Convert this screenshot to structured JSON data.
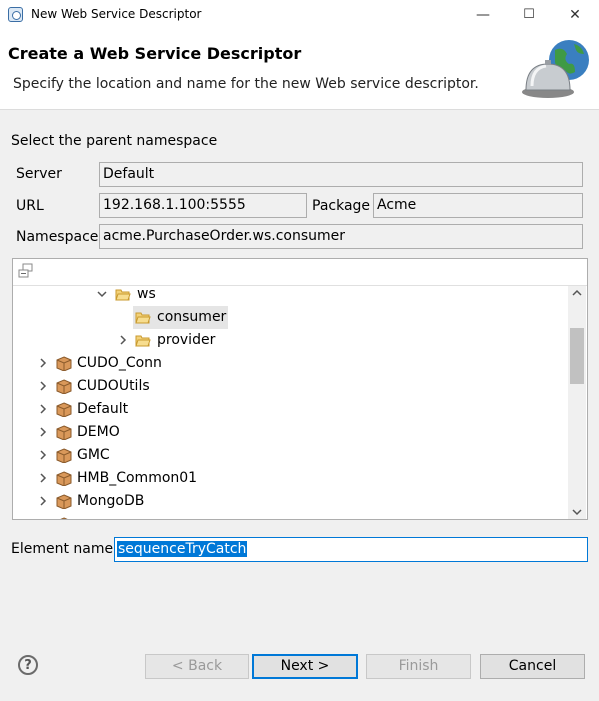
{
  "window": {
    "title": "New Web Service Descriptor",
    "controls": {
      "minimize": "—",
      "maximize": "☐",
      "close": "✕"
    }
  },
  "banner": {
    "title": "Create a Web Service Descriptor",
    "description": "Specify the location and name for the new Web service descriptor.",
    "image_icon": "service-bell-globe-icon"
  },
  "form": {
    "section_label": "Select the parent namespace",
    "server": {
      "label": "Server",
      "value": "Default"
    },
    "url": {
      "label": "URL",
      "value": "192.168.1.100:5555"
    },
    "package": {
      "label": "Package",
      "value": "Acme"
    },
    "namespace": {
      "label": "Namespace",
      "value": "acme.PurchaseOrder.ws.consumer"
    }
  },
  "tree": {
    "toolbar_icon": "collapse-all-icon",
    "items": [
      {
        "label": "ws",
        "type": "folder",
        "expanded": true
      },
      {
        "label": "consumer",
        "type": "folder",
        "selected": true
      },
      {
        "label": "provider",
        "type": "folder"
      },
      {
        "label": "CUDO_Conn",
        "type": "package"
      },
      {
        "label": "CUDOUtils",
        "type": "package"
      },
      {
        "label": "Default",
        "type": "package"
      },
      {
        "label": "DEMO",
        "type": "package"
      },
      {
        "label": "GMC",
        "type": "package"
      },
      {
        "label": "HMB_Common01",
        "type": "package"
      },
      {
        "label": "MongoDB",
        "type": "package"
      }
    ]
  },
  "element_name": {
    "label": "Element name",
    "value": "sequenceTryCatch"
  },
  "buttons": {
    "back": "< Back",
    "next": "Next >",
    "finish": "Finish",
    "cancel": "Cancel"
  },
  "colors": {
    "accent": "#0078d7",
    "folder": "#e8b84a",
    "package": "#c8874a"
  }
}
